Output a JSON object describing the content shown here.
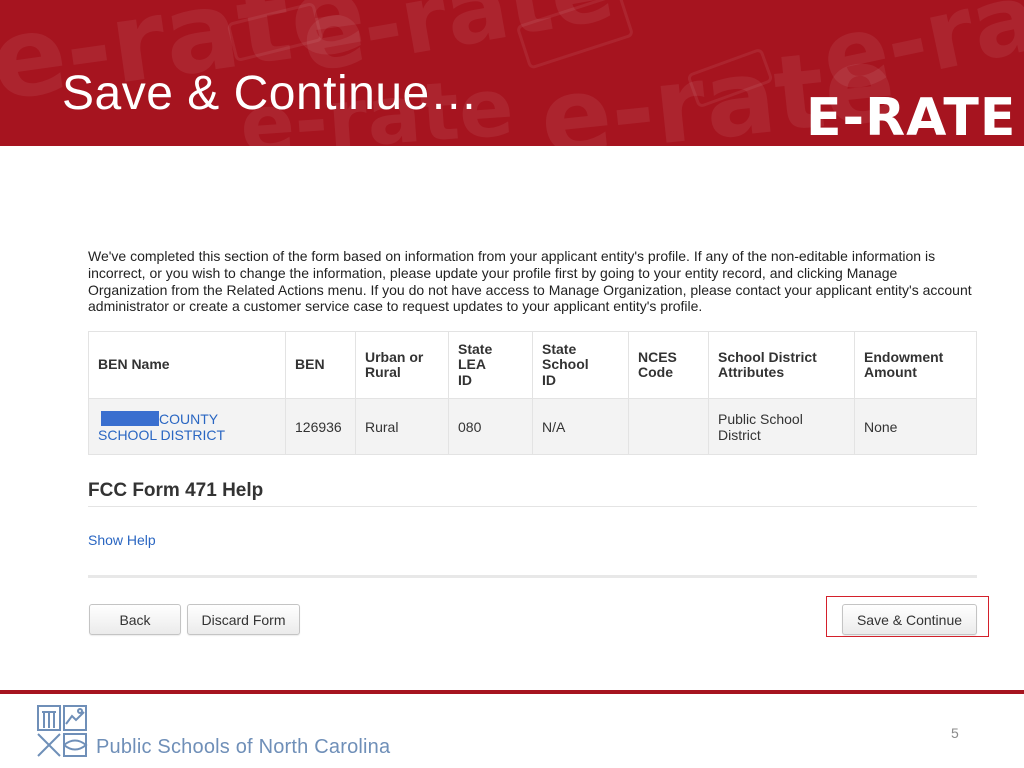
{
  "slide": {
    "title": "Save & Continue…",
    "brand": "E-RATE",
    "watermark_text": "e-rate",
    "colors": {
      "banner": "#a6141f",
      "link": "#2a66c2",
      "highlight": "#d4202b",
      "footer_text": "#6f8fb8"
    }
  },
  "form": {
    "intro": "We've completed this section of the form based on information from your applicant entity's profile.  If any of the non-editable information is incorrect, or you wish to change the information, please update your profile first by going to your entity record, and clicking Manage Organization from the Related Actions menu.  If you do not have access to Manage Organization, please contact your applicant entity's account administrator or create a customer service case to request updates to your applicant entity's profile.",
    "table": {
      "headers": [
        "BEN Name",
        "BEN",
        "Urban or Rural",
        "State LEA ID",
        "State School ID",
        "NCES Code",
        "School District Attributes",
        "Endowment Amount"
      ],
      "row": {
        "ben_name": "COUNTY SCHOOL DISTRICT",
        "ben": "126936",
        "urban_rural": "Rural",
        "state_lea_id": "080",
        "state_school_id": "N/A",
        "nces_code": "",
        "district_attributes": "Public School District",
        "endowment": "None"
      }
    },
    "help_heading": "FCC Form 471 Help",
    "show_help": "Show Help",
    "buttons": {
      "back": "Back",
      "discard": "Discard Form",
      "save_continue": "Save & Continue"
    }
  },
  "footer": {
    "org_name": "Public Schools of North Carolina",
    "page_number": "5",
    "logo_icon": "nc-dpi-logo-icon"
  }
}
